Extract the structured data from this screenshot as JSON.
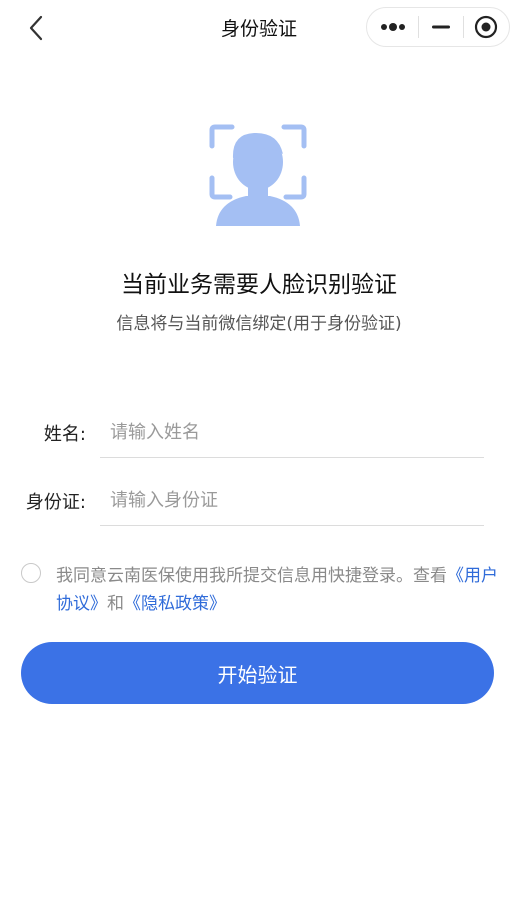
{
  "navbar": {
    "title": "身份验证",
    "back_icon": "chevron-left-icon",
    "more_icon": "more-dots-icon",
    "minimize_icon": "minus-icon",
    "close_icon": "target-circle-icon"
  },
  "hero": {
    "icon": "face-scan-icon",
    "icon_color": "#a4bff3",
    "headline": "当前业务需要人脸识别验证",
    "subline": "信息将与当前微信绑定(用于身份验证)"
  },
  "form": {
    "name_label": "姓名:",
    "name_placeholder": "请输入姓名",
    "name_value": "",
    "id_label": "身份证:",
    "id_placeholder": "请输入身份证",
    "id_value": ""
  },
  "agreement": {
    "checked": false,
    "text": "我同意云南医保使用我所提交信息用快捷登录。查看",
    "link_user": "《用户协议》",
    "conjunction": "和",
    "link_privacy": "《隐私政策》"
  },
  "primary_button": {
    "label": "开始验证",
    "color": "#3b72e6"
  }
}
